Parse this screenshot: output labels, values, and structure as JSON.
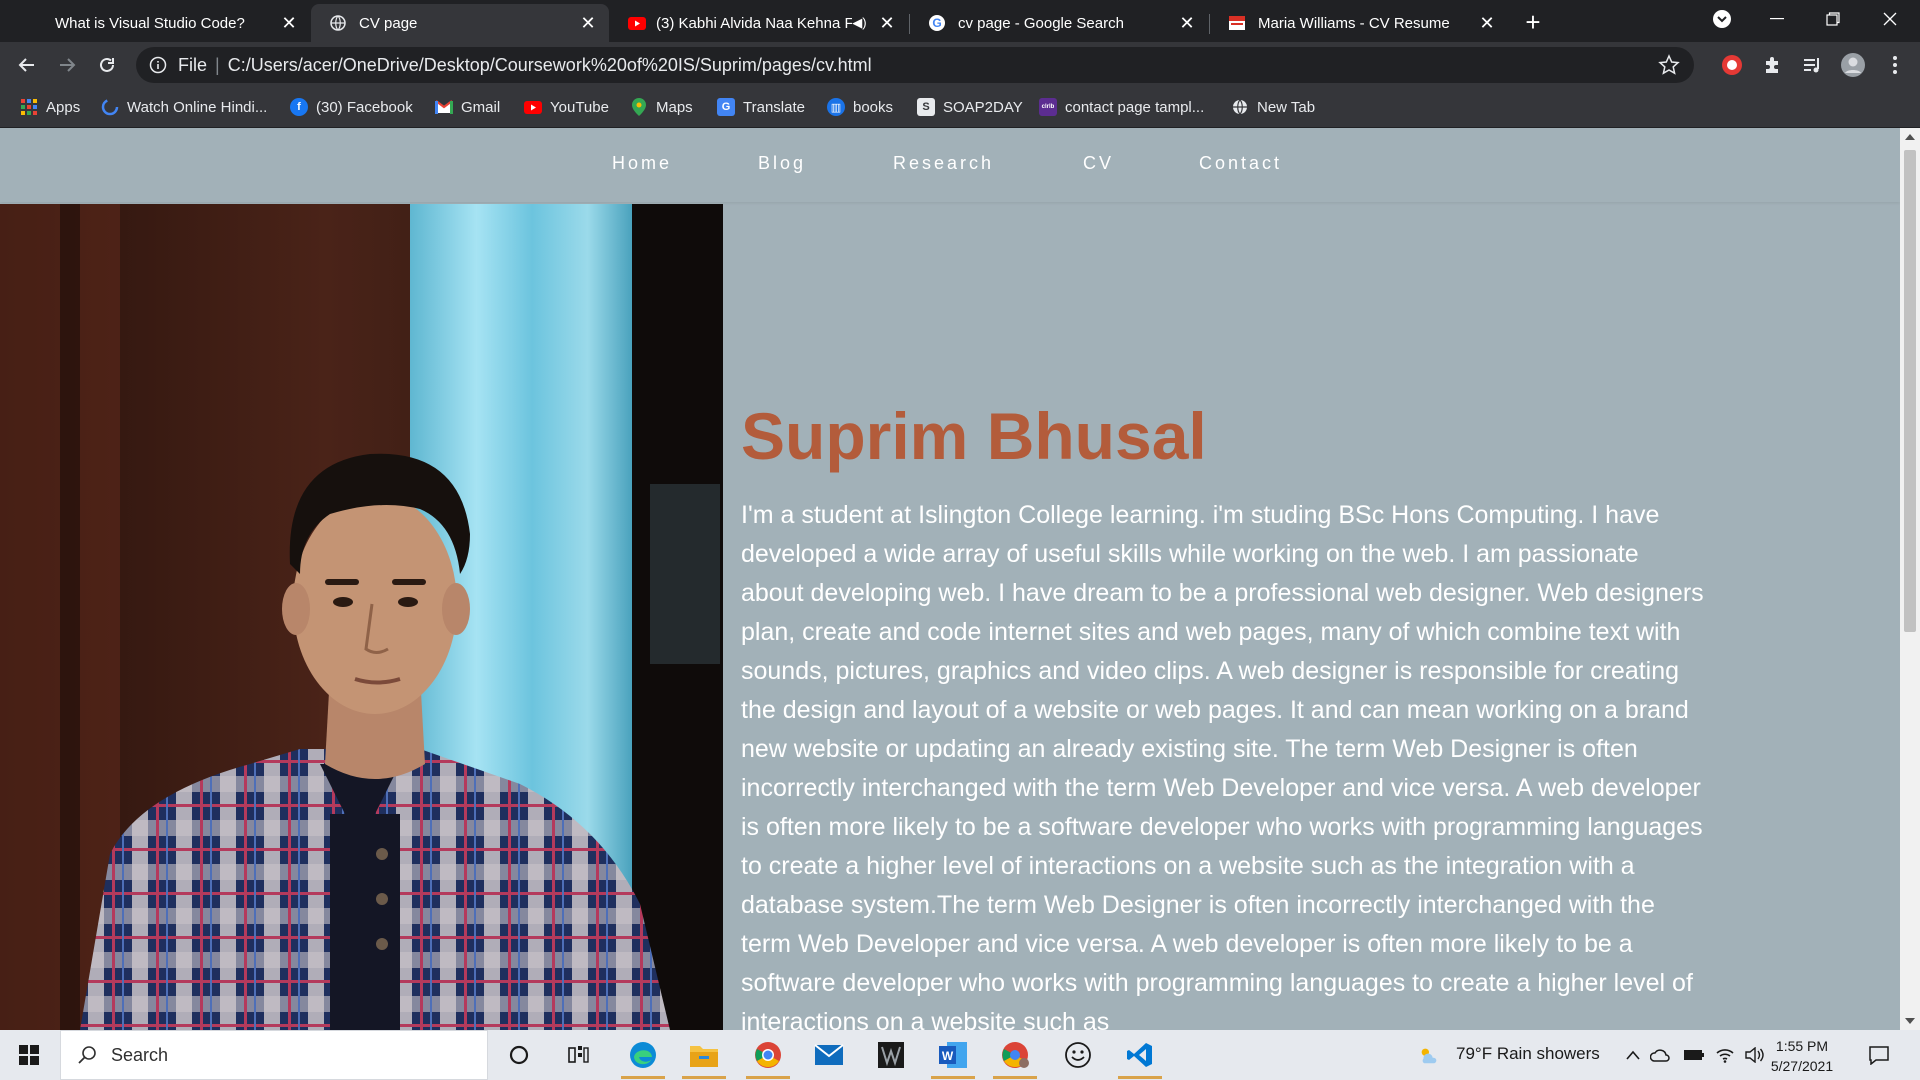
{
  "browser": {
    "tabs": [
      {
        "title": "What is Visual Studio Code?",
        "icon": "none",
        "active": false
      },
      {
        "title": "CV page",
        "icon": "globe-icon",
        "active": true
      },
      {
        "title": "(3) Kabhi Alvida Naa Kehna F",
        "icon": "youtube-icon",
        "active": false,
        "audio": true
      },
      {
        "title": "cv page - Google Search",
        "icon": "google-icon",
        "active": false
      },
      {
        "title": "Maria Williams - CV Resume",
        "icon": "resume-icon",
        "active": false
      }
    ],
    "new_tab_label": "+",
    "address": {
      "scheme_label": "File",
      "separator": "|",
      "url": "C:/Users/acer/OneDrive/Desktop/Coursework%20of%20IS/Suprim/pages/cv.html"
    },
    "bookmarks": [
      {
        "label": "Apps",
        "icon": "apps-grid-icon"
      },
      {
        "label": "Watch Online Hindi...",
        "icon": "loading-ring-icon"
      },
      {
        "label": "(30) Facebook",
        "icon": "facebook-icon"
      },
      {
        "label": "Gmail",
        "icon": "gmail-icon"
      },
      {
        "label": "YouTube",
        "icon": "youtube-icon"
      },
      {
        "label": "Maps",
        "icon": "maps-pin-icon"
      },
      {
        "label": "Translate",
        "icon": "translate-icon"
      },
      {
        "label": "books",
        "icon": "books-icon"
      },
      {
        "label": "SOAP2DAY",
        "icon": "soap2day-icon"
      },
      {
        "label": "contact page tampl...",
        "icon": "colorlib-icon"
      },
      {
        "label": "New Tab",
        "icon": "globe-icon"
      }
    ]
  },
  "page": {
    "nav": [
      "Home",
      "Blog",
      "Research",
      "CV",
      "Contact"
    ],
    "name": "Suprim Bhusal",
    "bio": "I'm a student at Islington College learning. i'm studing BSc Hons Computing. I have developed a wide array of useful skills while working on the web. I am passionate about developing web. I have dream to be a professional web designer. Web designers plan, create and code internet sites and web pages, many of which combine text with sounds, pictures, graphics and video clips. A web designer is responsible for creating the design and layout of a website or web pages. It and can mean working on a brand new website or updating an already existing site. The term Web Designer is often incorrectly interchanged with the term Web Developer and vice versa. A web developer is often more likely to be a software developer who works with programming languages to create a higher level of interactions on a website such as the integration with a database system.The term Web Designer is often incorrectly interchanged with the term Web Developer and vice versa. A web developer is often more likely to be a software developer who works with programming languages to create a higher level of interactions on a website such as",
    "colors": {
      "name": "#b35c3b",
      "background": "#a2b1b8",
      "text": "#ffffff"
    }
  },
  "taskbar": {
    "search_placeholder": "Search",
    "weather": "79°F  Rain showers",
    "time": "1:55 PM",
    "date": "5/27/2021"
  }
}
